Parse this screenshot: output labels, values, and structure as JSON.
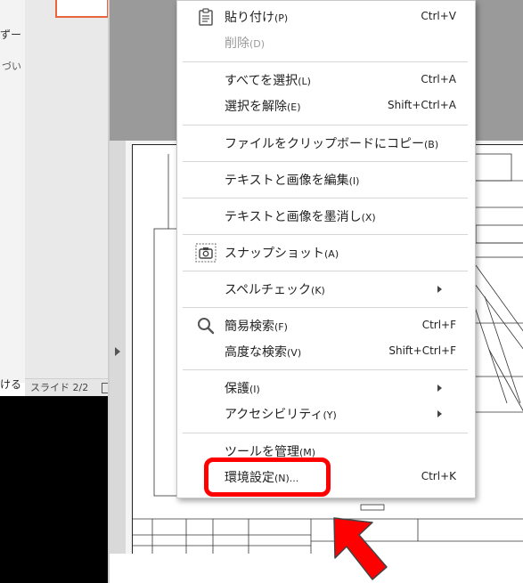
{
  "background": {
    "fragment_1": "ずー",
    "fragment_2": "づい",
    "fragment_3": "ける",
    "slide_status": "スライド 2/2"
  },
  "menu": {
    "items": [
      {
        "label": "貼り付け",
        "accel": "(P)",
        "shortcut": "Ctrl+V",
        "icon": "clipboard-icon"
      },
      {
        "label": "削除",
        "accel": "(D)",
        "shortcut": "",
        "disabled": true
      },
      {
        "label": "すべてを選択",
        "accel": "(L)",
        "shortcut": "Ctrl+A"
      },
      {
        "label": "選択を解除",
        "accel": "(E)",
        "shortcut": "Shift+Ctrl+A"
      },
      {
        "label": "ファイルをクリップボードにコピー",
        "accel": "(B)",
        "shortcut": ""
      },
      {
        "label": "テキストと画像を編集",
        "accel": "(I)",
        "shortcut": ""
      },
      {
        "label": "テキストと画像を墨消し",
        "accel": "(X)",
        "shortcut": ""
      },
      {
        "label": "スナップショット",
        "accel": "(A)",
        "shortcut": "",
        "icon": "camera-icon"
      },
      {
        "label": "スペルチェック",
        "accel": "(K)",
        "shortcut": "",
        "submenu": true
      },
      {
        "label": "簡易検索",
        "accel": "(F)",
        "shortcut": "Ctrl+F",
        "icon": "search-icon"
      },
      {
        "label": "高度な検索",
        "accel": "(V)",
        "shortcut": "Shift+Ctrl+F"
      },
      {
        "label": "保護",
        "accel": "(I)",
        "shortcut": "",
        "submenu": true
      },
      {
        "label": "アクセシビリティ",
        "accel": "(Y)",
        "shortcut": "",
        "submenu": true
      },
      {
        "label": "ツールを管理",
        "accel": "(M)",
        "shortcut": ""
      },
      {
        "label": "環境設定",
        "accel": "(N)...",
        "shortcut": "Ctrl+K",
        "highlighted": true
      }
    ]
  },
  "annotation": {
    "highlight_color": "#ff0000",
    "arrow_color": "#ff0000"
  }
}
